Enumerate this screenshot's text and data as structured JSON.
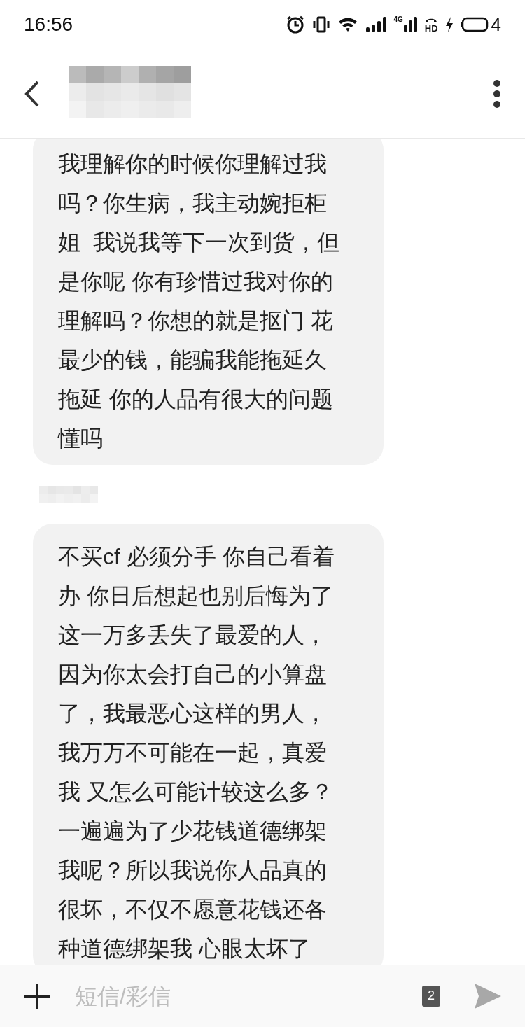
{
  "status_bar": {
    "time": "16:56",
    "network_type": "4G",
    "hd_label": "HD",
    "battery": "4"
  },
  "messages": [
    {
      "kind": "received",
      "text": "我理解你的时候你理解过我吗？你生病，我主动婉拒柜姐  我说我等下一次到货，但是你呢 你有珍惜过我对你的理解吗？你想的就是抠门 花最少的钱，能骗我能拖延久拖延 你的人品有很大的问题懂吗"
    },
    {
      "kind": "received",
      "text": "不买cf 必须分手 你自己看着办 你日后想起也别后悔为了这一万多丢失了最爱的人，因为你太会打自己的小算盘了，我最恶心这样的男人，我万万不可能在一起，真爱我 又怎么可能计较这么多？一遍遍为了少花钱道德绑架我呢？所以我说你人品真的很坏，不仅不愿意花钱还各种道德绑架我 心眼太坏了"
    }
  ],
  "composer": {
    "placeholder": "短信/彩信",
    "sim_slot": "2"
  }
}
